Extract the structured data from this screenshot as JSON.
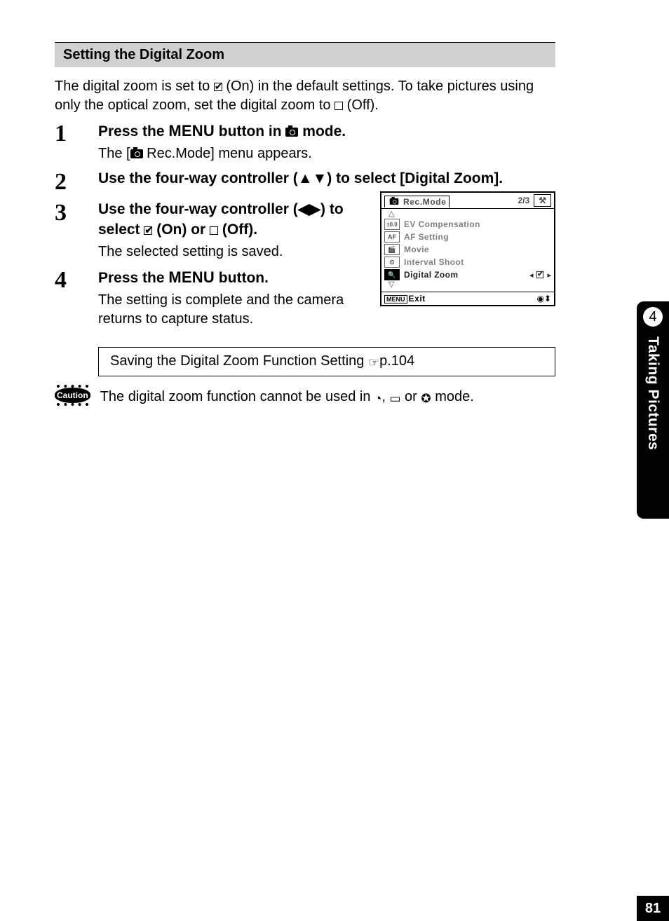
{
  "section_title": "Setting the Digital Zoom",
  "intro_a": "The digital zoom is set to ",
  "intro_b": " (On) in the default settings. To take pictures using only the optical zoom, set the digital zoom to ",
  "intro_c": " (Off).",
  "steps": {
    "s1": {
      "num": "1",
      "title_a": "Press the ",
      "title_menu": "MENU",
      "title_b": " button in ",
      "title_c": " mode.",
      "sub_a": "The [",
      "sub_b": " Rec.Mode] menu appears."
    },
    "s2": {
      "num": "2",
      "title": "Use the four-way controller (▲▼) to select [Digital Zoom]."
    },
    "s3": {
      "num": "3",
      "title_a": "Use the four-way controller (◀▶) to select ",
      "title_b": " (On) or ",
      "title_c": " (Off).",
      "sub": "The selected setting is saved."
    },
    "s4": {
      "num": "4",
      "title_a": "Press the ",
      "title_menu": "MENU",
      "title_b": " button.",
      "sub": "The setting is complete and the camera returns to capture status."
    }
  },
  "lcd": {
    "title": "Rec.Mode",
    "page": "2/3",
    "rows": {
      "r1": {
        "icon": "±0.0",
        "label": "EV Compensation"
      },
      "r2": {
        "icon": "AF",
        "label": "AF Setting"
      },
      "r3": {
        "icon": "🎬",
        "label": "Movie"
      },
      "r4": {
        "icon": "⏲",
        "label": "Interval Shoot"
      },
      "r5": {
        "icon": "🔍",
        "label": "Digital Zoom"
      }
    },
    "exit": "Exit",
    "menu_label": "MENU"
  },
  "ref_a": "Saving the Digital Zoom Function Setting ",
  "ref_b": "p.104",
  "caution_label": "Caution",
  "caution_a": "The digital zoom function cannot be used in ",
  "caution_b": ", ",
  "caution_c": " or ",
  "caution_d": " mode.",
  "side": {
    "chapter": "4",
    "title": "Taking Pictures"
  },
  "page_number": "81"
}
